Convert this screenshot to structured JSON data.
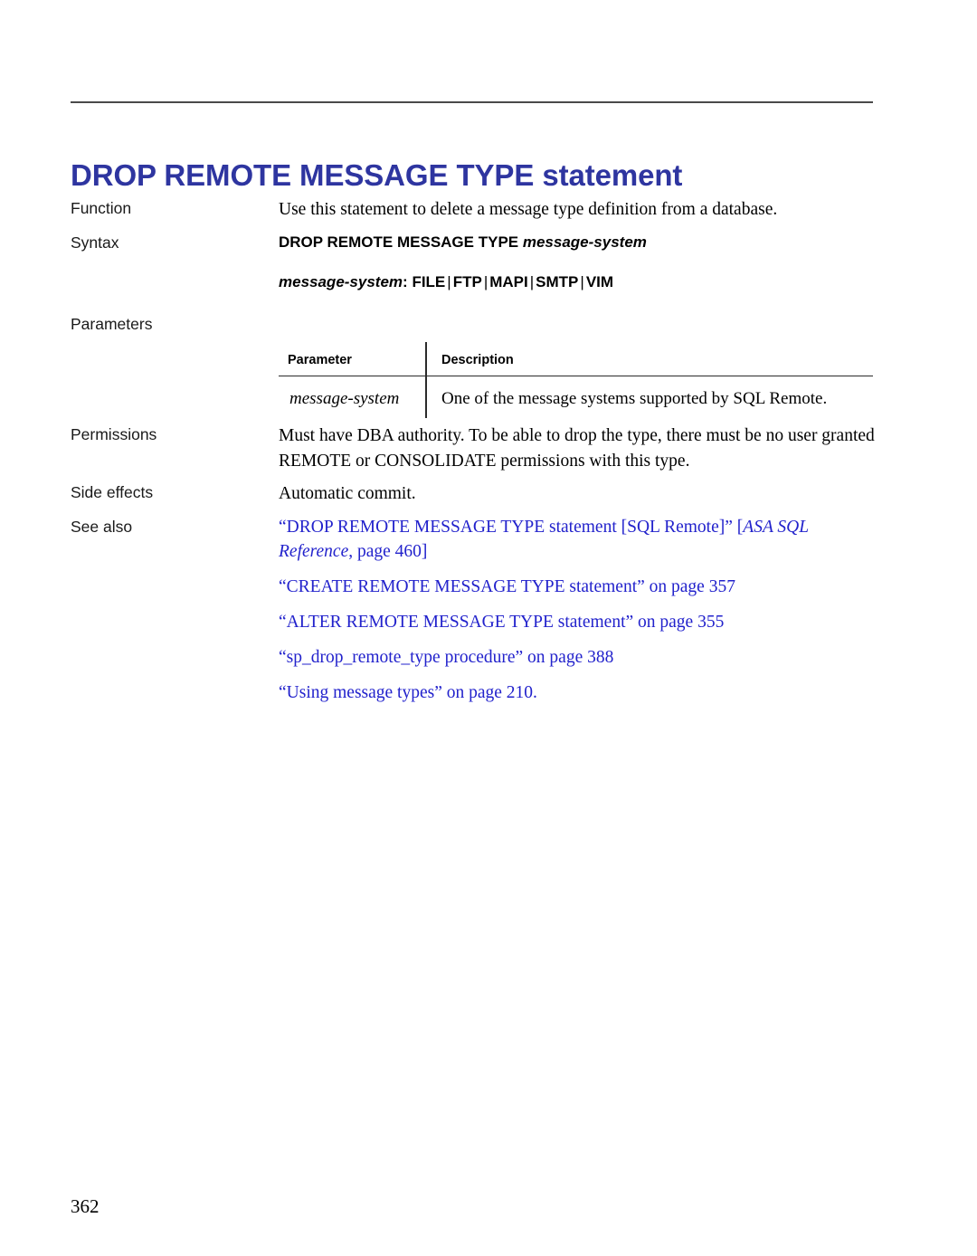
{
  "document": {
    "title_main": "DROP REMOTE MESSAGE TYPE",
    "title_tail": " statement",
    "folio": "362",
    "title_color": "#2e35a0",
    "link_color": "#2222cc"
  },
  "rows": {
    "function": {
      "label": "Function",
      "text": "Use this statement to delete a message type definition from a database."
    },
    "syntax": {
      "label": "Syntax",
      "line1_keyword": "DROP REMOTE MESSAGE TYPE",
      "line1_placeholder": "message-system",
      "line2_placeholder": "message-system",
      "line2_colon": ":",
      "line2_options": [
        "FILE",
        "FTP",
        "MAPI",
        "SMTP",
        "VIM"
      ],
      "separator": "|"
    },
    "parameters": {
      "label": "Parameters"
    },
    "permissions": {
      "label": "Permissions",
      "text": "Must have DBA authority. To be able to drop the type, there must be no user granted REMOTE or CONSOLIDATE permissions with this type."
    },
    "side_effects": {
      "label": "Side effects",
      "text": "Automatic commit."
    },
    "see_also": {
      "label": "See also"
    }
  },
  "param_table": {
    "headers": [
      "Parameter",
      "Description"
    ],
    "rows": [
      {
        "parameter": "message-system",
        "description": "One of the message systems supported by SQL Remote."
      }
    ]
  },
  "see_also_links": [
    {
      "part1": "“DROP REMOTE MESSAGE TYPE statement [SQL Remote]” [",
      "italic": "ASA SQL Reference",
      "part2": ", page 460]"
    },
    {
      "part1": "“CREATE REMOTE MESSAGE TYPE statement” on page 357",
      "italic": "",
      "part2": ""
    },
    {
      "part1": "“ALTER REMOTE MESSAGE TYPE statement” on page 355",
      "italic": "",
      "part2": ""
    },
    {
      "part1": "“sp_drop_remote_type procedure” on page 388",
      "italic": "",
      "part2": ""
    },
    {
      "part1": "“Using message types” on page 210.",
      "italic": "",
      "part2": ""
    }
  ]
}
